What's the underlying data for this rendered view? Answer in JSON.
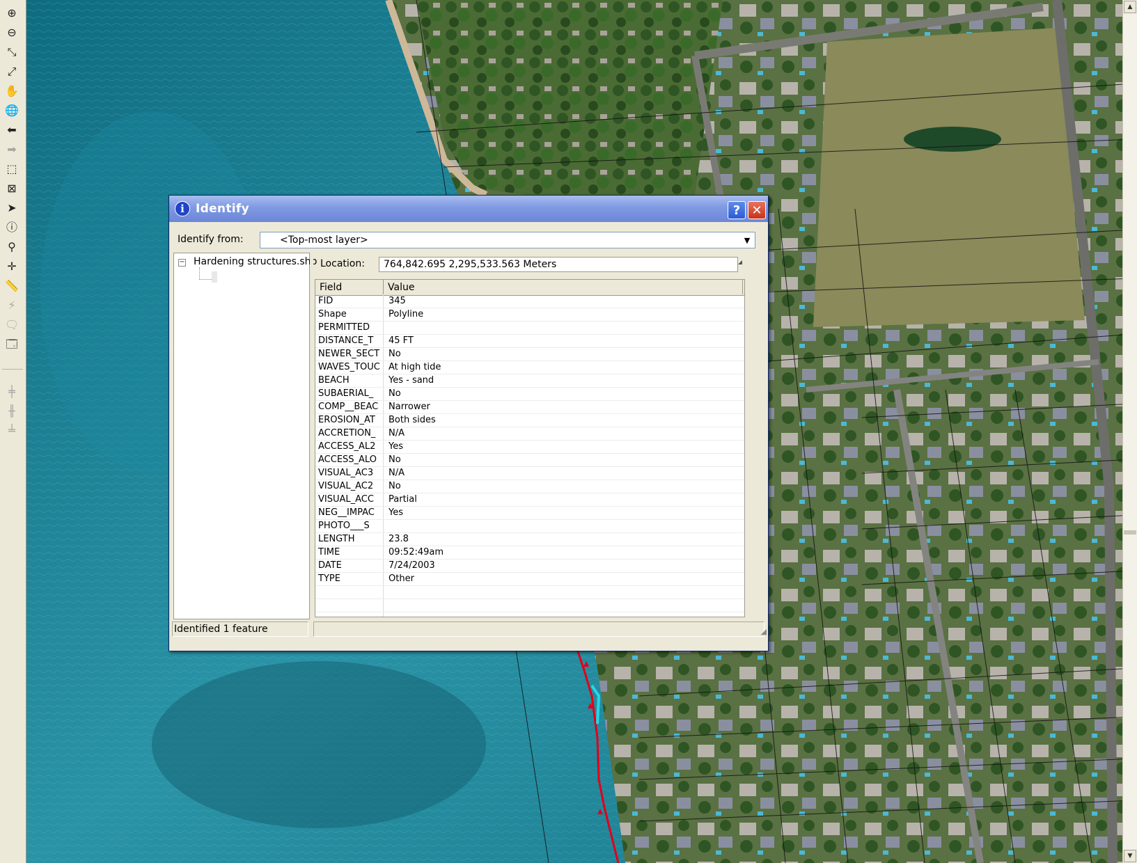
{
  "identify_dialog": {
    "title": "Identify",
    "identify_from_label": "Identify from:",
    "identify_from_value": "<Top-most layer>",
    "tree": {
      "layer_name": "Hardening structures.shp",
      "expander": "−"
    },
    "location_label": "Location:",
    "location_value": "764,842.695  2,295,533.563 Meters",
    "grid_headers": {
      "field": "Field",
      "value": "Value"
    },
    "rows": [
      {
        "field": "FID",
        "value": "345"
      },
      {
        "field": "Shape",
        "value": "Polyline"
      },
      {
        "field": "PERMITTED",
        "value": ""
      },
      {
        "field": "DISTANCE_T",
        "value": "45 FT"
      },
      {
        "field": "NEWER_SECT",
        "value": "No"
      },
      {
        "field": "WAVES_TOUC",
        "value": "At high tide"
      },
      {
        "field": "BEACH",
        "value": "Yes - sand"
      },
      {
        "field": "SUBAERIAL_",
        "value": "No"
      },
      {
        "field": "COMP__BEAC",
        "value": "Narrower"
      },
      {
        "field": "EROSION_AT",
        "value": "Both sides"
      },
      {
        "field": "ACCRETION_",
        "value": "N/A"
      },
      {
        "field": "ACCESS_AL2",
        "value": "Yes"
      },
      {
        "field": "ACCESS_ALO",
        "value": "No"
      },
      {
        "field": "VISUAL_AC3",
        "value": "N/A"
      },
      {
        "field": "VISUAL_AC2",
        "value": "No"
      },
      {
        "field": "VISUAL_ACC",
        "value": "Partial"
      },
      {
        "field": "NEG__IMPAC",
        "value": "Yes"
      },
      {
        "field": "PHOTO___S",
        "value": ""
      },
      {
        "field": "LENGTH",
        "value": "23.8"
      },
      {
        "field": "TIME",
        "value": "09:52:49am"
      },
      {
        "field": "DATE",
        "value": "7/24/2003"
      },
      {
        "field": "TYPE",
        "value": "Other"
      }
    ],
    "status_text": "Identified 1 feature",
    "help_glyph": "?",
    "close_glyph": "✕",
    "info_glyph": "i",
    "dropdown_glyph": "▼"
  },
  "toolbar": {
    "tools": [
      {
        "name": "zoom-in-icon",
        "glyph": "⊕",
        "enabled": true
      },
      {
        "name": "zoom-out-icon",
        "glyph": "⊖",
        "enabled": true
      },
      {
        "name": "fixed-zoom-in-icon",
        "glyph": "⤡",
        "enabled": true
      },
      {
        "name": "fixed-zoom-out-icon",
        "glyph": "⤢",
        "enabled": true
      },
      {
        "name": "pan-hand-icon",
        "glyph": "✋",
        "enabled": true
      },
      {
        "name": "full-extent-globe-icon",
        "glyph": "🌐",
        "enabled": true
      },
      {
        "name": "back-arrow-icon",
        "glyph": "⬅",
        "enabled": true
      },
      {
        "name": "forward-arrow-icon",
        "glyph": "➡",
        "enabled": false
      },
      {
        "name": "select-features-icon",
        "glyph": "⬚",
        "enabled": true
      },
      {
        "name": "clear-selection-icon",
        "glyph": "⊠",
        "enabled": true
      },
      {
        "name": "select-elements-arrow-icon",
        "glyph": "➤",
        "enabled": true
      },
      {
        "name": "identify-info-icon",
        "glyph": "ⓘ",
        "enabled": true
      },
      {
        "name": "find-binoculars-icon",
        "glyph": "⚲",
        "enabled": true
      },
      {
        "name": "go-to-xy-icon",
        "glyph": "✛",
        "enabled": true
      },
      {
        "name": "measure-ruler-icon",
        "glyph": "📏",
        "enabled": true
      },
      {
        "name": "hyperlink-lightning-icon",
        "glyph": "⚡",
        "enabled": false
      },
      {
        "name": "html-popup-icon",
        "glyph": "🗨",
        "enabled": false
      },
      {
        "name": "map-tips-icon",
        "glyph": "🗔",
        "enabled": true
      },
      {
        "name": "edit-tool-1-icon",
        "glyph": "╪",
        "enabled": false
      },
      {
        "name": "edit-tool-2-icon",
        "glyph": "╫",
        "enabled": false
      },
      {
        "name": "edit-tool-3-icon",
        "glyph": "╧",
        "enabled": false
      }
    ]
  },
  "scrollbar": {
    "up_glyph": "▲",
    "down_glyph": "▼"
  },
  "colors": {
    "ocean": "#1e7d8c",
    "shoreline": "#e0001b",
    "highlight": "#27d6e6",
    "title_bar": "#7f99e3",
    "dialog_face": "#ece9d8"
  }
}
